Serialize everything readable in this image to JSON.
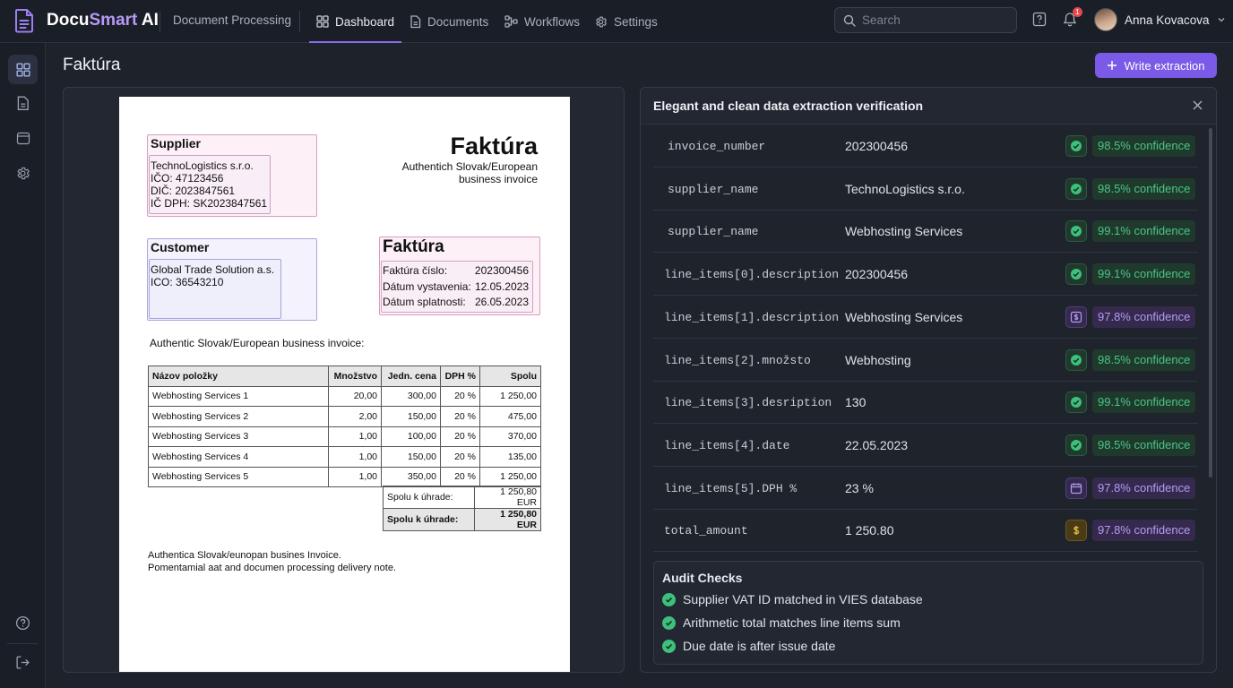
{
  "app": {
    "brand_a": "Docu",
    "brand_b": "Smart",
    "brand_c": " AI",
    "section": "Document Processing"
  },
  "nav": [
    {
      "label": "Dashboard",
      "icon": "grid-icon",
      "active": true
    },
    {
      "label": "Documents",
      "icon": "document-icon",
      "active": false
    },
    {
      "label": "Workflows",
      "icon": "workflow-icon",
      "active": false
    },
    {
      "label": "Settings",
      "icon": "gear-icon",
      "active": false
    }
  ],
  "search": {
    "placeholder": "Search"
  },
  "notifications": {
    "count": "1"
  },
  "user": {
    "name": "Anna Kovacova"
  },
  "page": {
    "title": "Faktúra",
    "action_label": "Write extraction"
  },
  "document": {
    "supplier_heading": "Supplier",
    "supplier_lines": [
      "TechnoLogistics s.r.o.",
      "IČO: 47123456",
      "DIČ: 2023847561",
      "IČ DPH: SK2023847561"
    ],
    "title": "Faktúra",
    "subtitle_1": "Authentich Slovak/European",
    "subtitle_2": "business invoice",
    "customer_heading": "Customer",
    "customer_lines": [
      "Global Trade Solution a.s.",
      "ICO: 36543210"
    ],
    "invoice_box_title": "Faktúra",
    "invoice_meta": [
      {
        "label": "Faktúra číslo:",
        "value": "202300456"
      },
      {
        "label": "Dátum vystavenia:",
        "value": "12.05.2023"
      },
      {
        "label": "Dátum splatnosti:",
        "value": "26.05.2023"
      }
    ],
    "intro": "Authentic Slovak/European business invoice:",
    "table_headers": [
      "Názov položky",
      "Množstvo",
      "Jedn. cena",
      "DPH %",
      "Spolu"
    ],
    "table_rows": [
      [
        "Webhosting Services 1",
        "20,00",
        "300,00",
        "20 %",
        "1 250,00"
      ],
      [
        "Webhosting Services 2",
        "2,00",
        "150,00",
        "20 %",
        "475,00"
      ],
      [
        "Webhosting Services 3",
        "1,00",
        "100,00",
        "20 %",
        "370,00"
      ],
      [
        "Webhosting Services 4",
        "1,00",
        "150,00",
        "20 %",
        "135,00"
      ],
      [
        "Webhosting Services 5",
        "1,00",
        "350,00",
        "20 %",
        "1 250,00"
      ]
    ],
    "totals": [
      {
        "label": "Spolu k úhrade:",
        "value": "1 250,80 EUR"
      },
      {
        "label": "Spolu k úhrade:",
        "value": "1 250,80 EUR"
      }
    ],
    "footer_1": "Authentica Slovak/eunopan busines Invoice.",
    "footer_2": "Pomentamial aat and documen processing delivery note."
  },
  "verification": {
    "title": "Elegant and clean data extraction verification",
    "fields": [
      {
        "field": "invoice_number",
        "value": "202300456",
        "status": "ok",
        "icon": "check-circle-icon",
        "confidence": "98.5% confidence"
      },
      {
        "field": "supplier_name",
        "value": "TechnoLogistics s.r.o.",
        "status": "ok",
        "icon": "check-circle-icon",
        "confidence": "98.5% confidence"
      },
      {
        "field": "supplier_name",
        "value": "Webhosting Services",
        "status": "ok",
        "icon": "check-circle-icon",
        "confidence": "99.1% confidence"
      },
      {
        "field": "line_items[0].description",
        "value": "202300456",
        "status": "ok",
        "icon": "check-circle-icon",
        "confidence": "99.1% confidence"
      },
      {
        "field": "line_items[1].description",
        "value": "Webhosting Services",
        "status": "info",
        "icon": "dollar-box-icon",
        "confidence": "97.8% confidence"
      },
      {
        "field": "line_items[2].množsto",
        "value": "Webhosting",
        "status": "ok",
        "icon": "check-circle-icon",
        "confidence": "98.5% confidence"
      },
      {
        "field": "line_items[3].desription",
        "value": "130",
        "status": "ok",
        "icon": "check-circle-icon",
        "confidence": "99.1% confidence"
      },
      {
        "field": "line_items[4].date",
        "value": "22.05.2023",
        "status": "ok",
        "icon": "check-circle-icon",
        "confidence": "98.5% confidence"
      },
      {
        "field": "line_items[5].DPH %",
        "value": "23 %",
        "status": "info",
        "icon": "calendar-icon",
        "confidence": "97.8% confidence"
      },
      {
        "field": "total_amount",
        "value": "1 250.80",
        "status": "warn",
        "icon": "dollar-icon",
        "confidence": "97.8% confidence"
      }
    ],
    "audit_title": "Audit Checks",
    "audit_checks": [
      "Supplier VAT ID matched in VIES database",
      "Arithmetic total matches line items sum",
      "Due date is after issue date"
    ]
  },
  "colors": {
    "accent": "#7a5ae6",
    "success": "#4bc586",
    "info": "#b49af2",
    "warning": "#e0b341"
  }
}
